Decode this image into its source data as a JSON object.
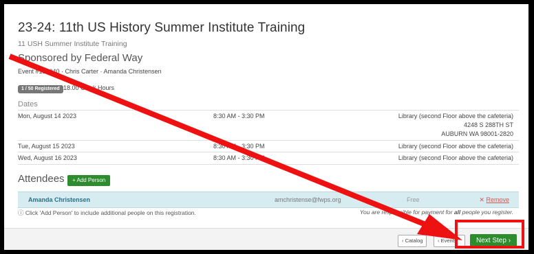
{
  "event": {
    "title": "23-24: 11th US History Summer Institute Training",
    "subtitle": "11 USH Summer Institute Training",
    "sponsor": "Sponsored by Federal Way",
    "event_line": "Event #156040 · Chris Carter · Amanda Christensen",
    "registered_badge": "1 / 50 Registered",
    "clock_hours": "18.00 Clock Hours"
  },
  "dates": {
    "heading": "Dates",
    "rows": [
      {
        "date": "Mon, August 14 2023",
        "time": "8:30 AM - 3:30 PM",
        "location": [
          "Library (second Floor above the cafeteria)",
          "4248 S 288TH ST",
          "AUBURN WA 98001-2820"
        ]
      },
      {
        "date": "Tue, August 15 2023",
        "time": "8:30 AM - 3:30 PM",
        "location": [
          "Library (second Floor above the cafeteria)"
        ]
      },
      {
        "date": "Wed, August 16 2023",
        "time": "8:30 AM - 3:30 PM",
        "location": [
          "Library (second Floor above the cafeteria)"
        ]
      }
    ]
  },
  "attendees": {
    "heading": "Attendees",
    "add_button": "+ Add Person",
    "rows": [
      {
        "name": "Amanda Christensen",
        "email": "amchristense@fwps.org",
        "fee": "Free",
        "remove": "Remove"
      }
    ],
    "info_text": "Click 'Add Person' to include additional people on this registration.",
    "responsibility_pre": "You are responsible for payment for ",
    "responsibility_bold": "all",
    "responsibility_post": " people you register."
  },
  "footer": {
    "catalog_label": "Catalog",
    "events_label": "Events",
    "next_label": "Next Step"
  },
  "annotation": {
    "highlight_color": "#ee1111"
  },
  "icons": [
    "info-icon",
    "chevron-left-icon",
    "chevron-right-icon",
    "times-icon",
    "red-arrow-annotation"
  ]
}
